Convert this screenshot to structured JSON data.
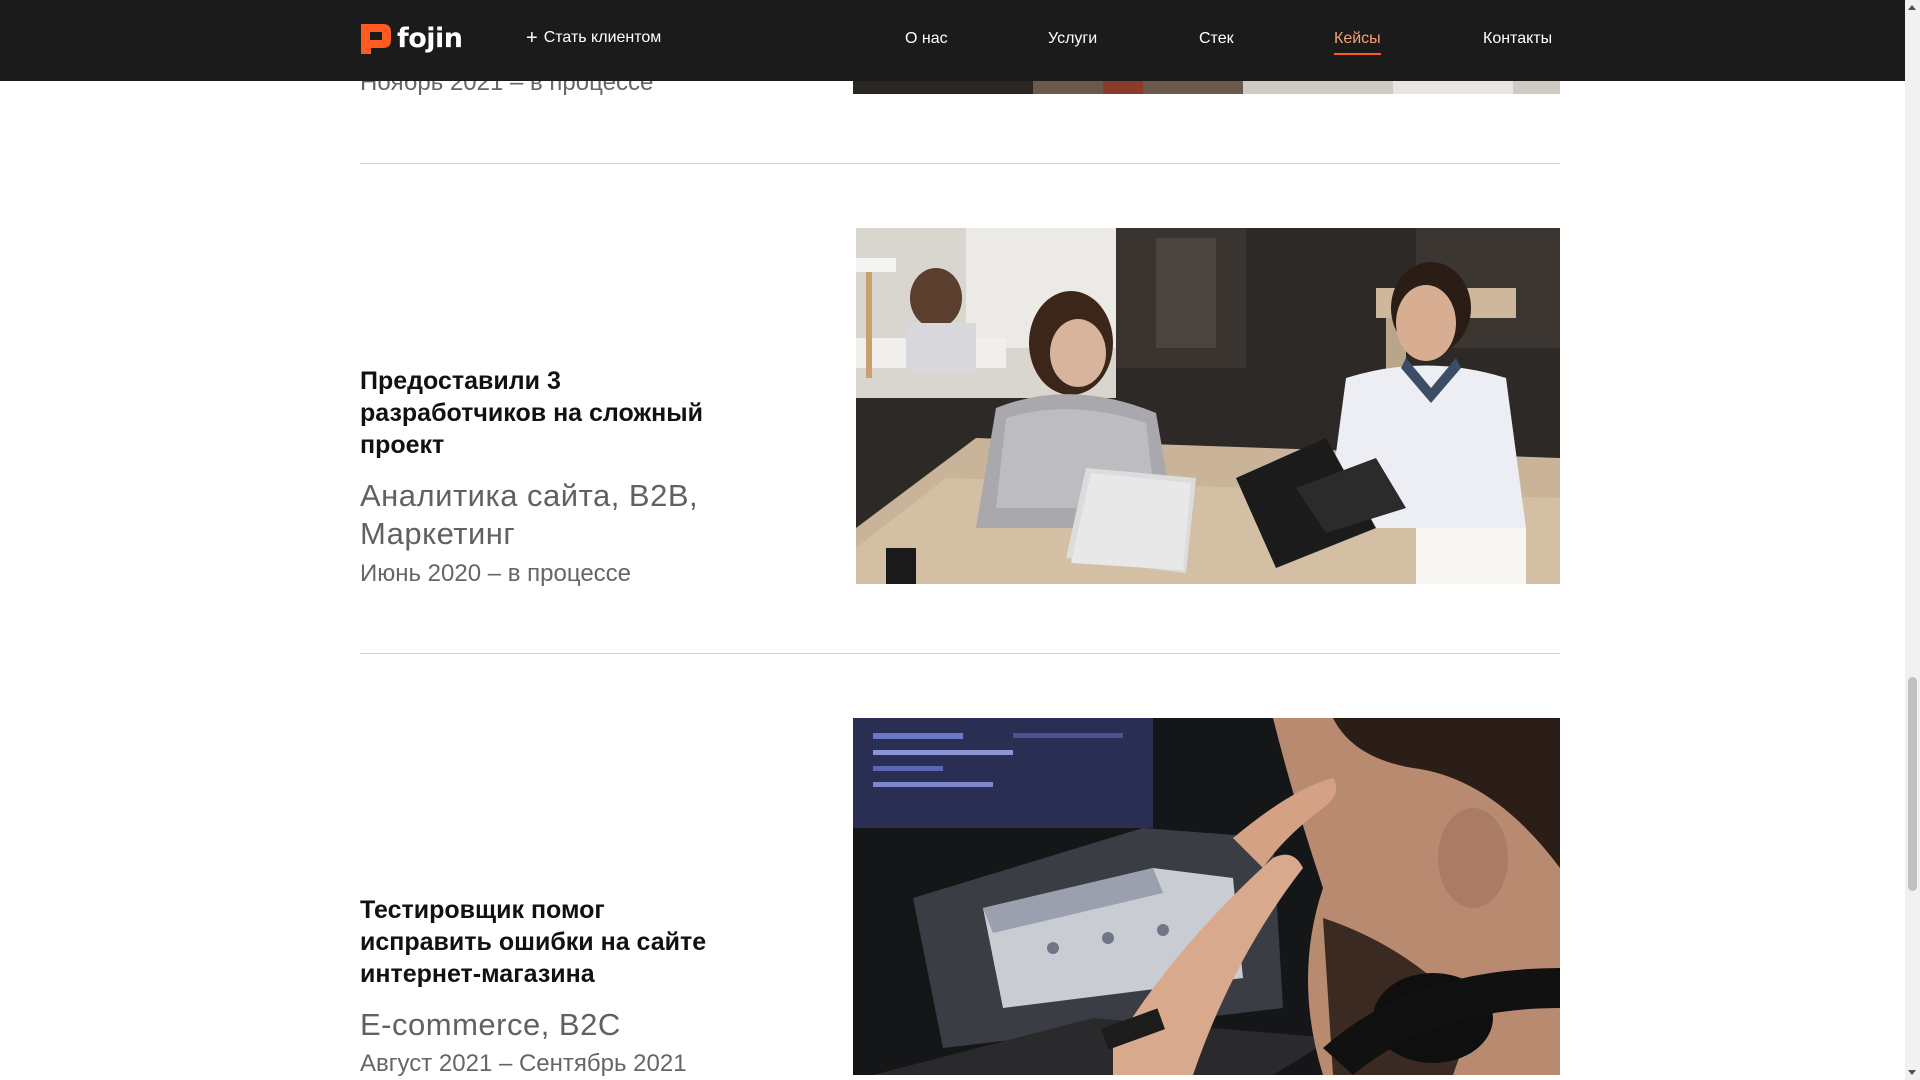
{
  "header": {
    "logo_text": "fojin",
    "cta_label": "Стать клиентом",
    "nav": [
      {
        "label": "О нас",
        "active": false
      },
      {
        "label": "Услуги",
        "active": false
      },
      {
        "label": "Стек",
        "active": false
      },
      {
        "label": "Кейсы",
        "active": true
      },
      {
        "label": "Контакты",
        "active": false
      }
    ]
  },
  "cases": [
    {
      "dates": "Ноябрь 2021 – в процессе"
    },
    {
      "title": "Предоставили 3 разработчиков на сложный проект",
      "tags": "Аналитика сайта, B2B, Маркетинг",
      "dates": "Июнь 2020 – в процессе"
    },
    {
      "title": "Тестировщик помог исправить ошибки на сайте интернет-магазина",
      "tags": "E-commerce, B2C",
      "dates": "Август 2021 – Сентябрь 2021"
    }
  ],
  "colors": {
    "header_bg": "#1b1b1b",
    "accent": "#ff5a1f",
    "active_nav": "#f2a37a"
  }
}
